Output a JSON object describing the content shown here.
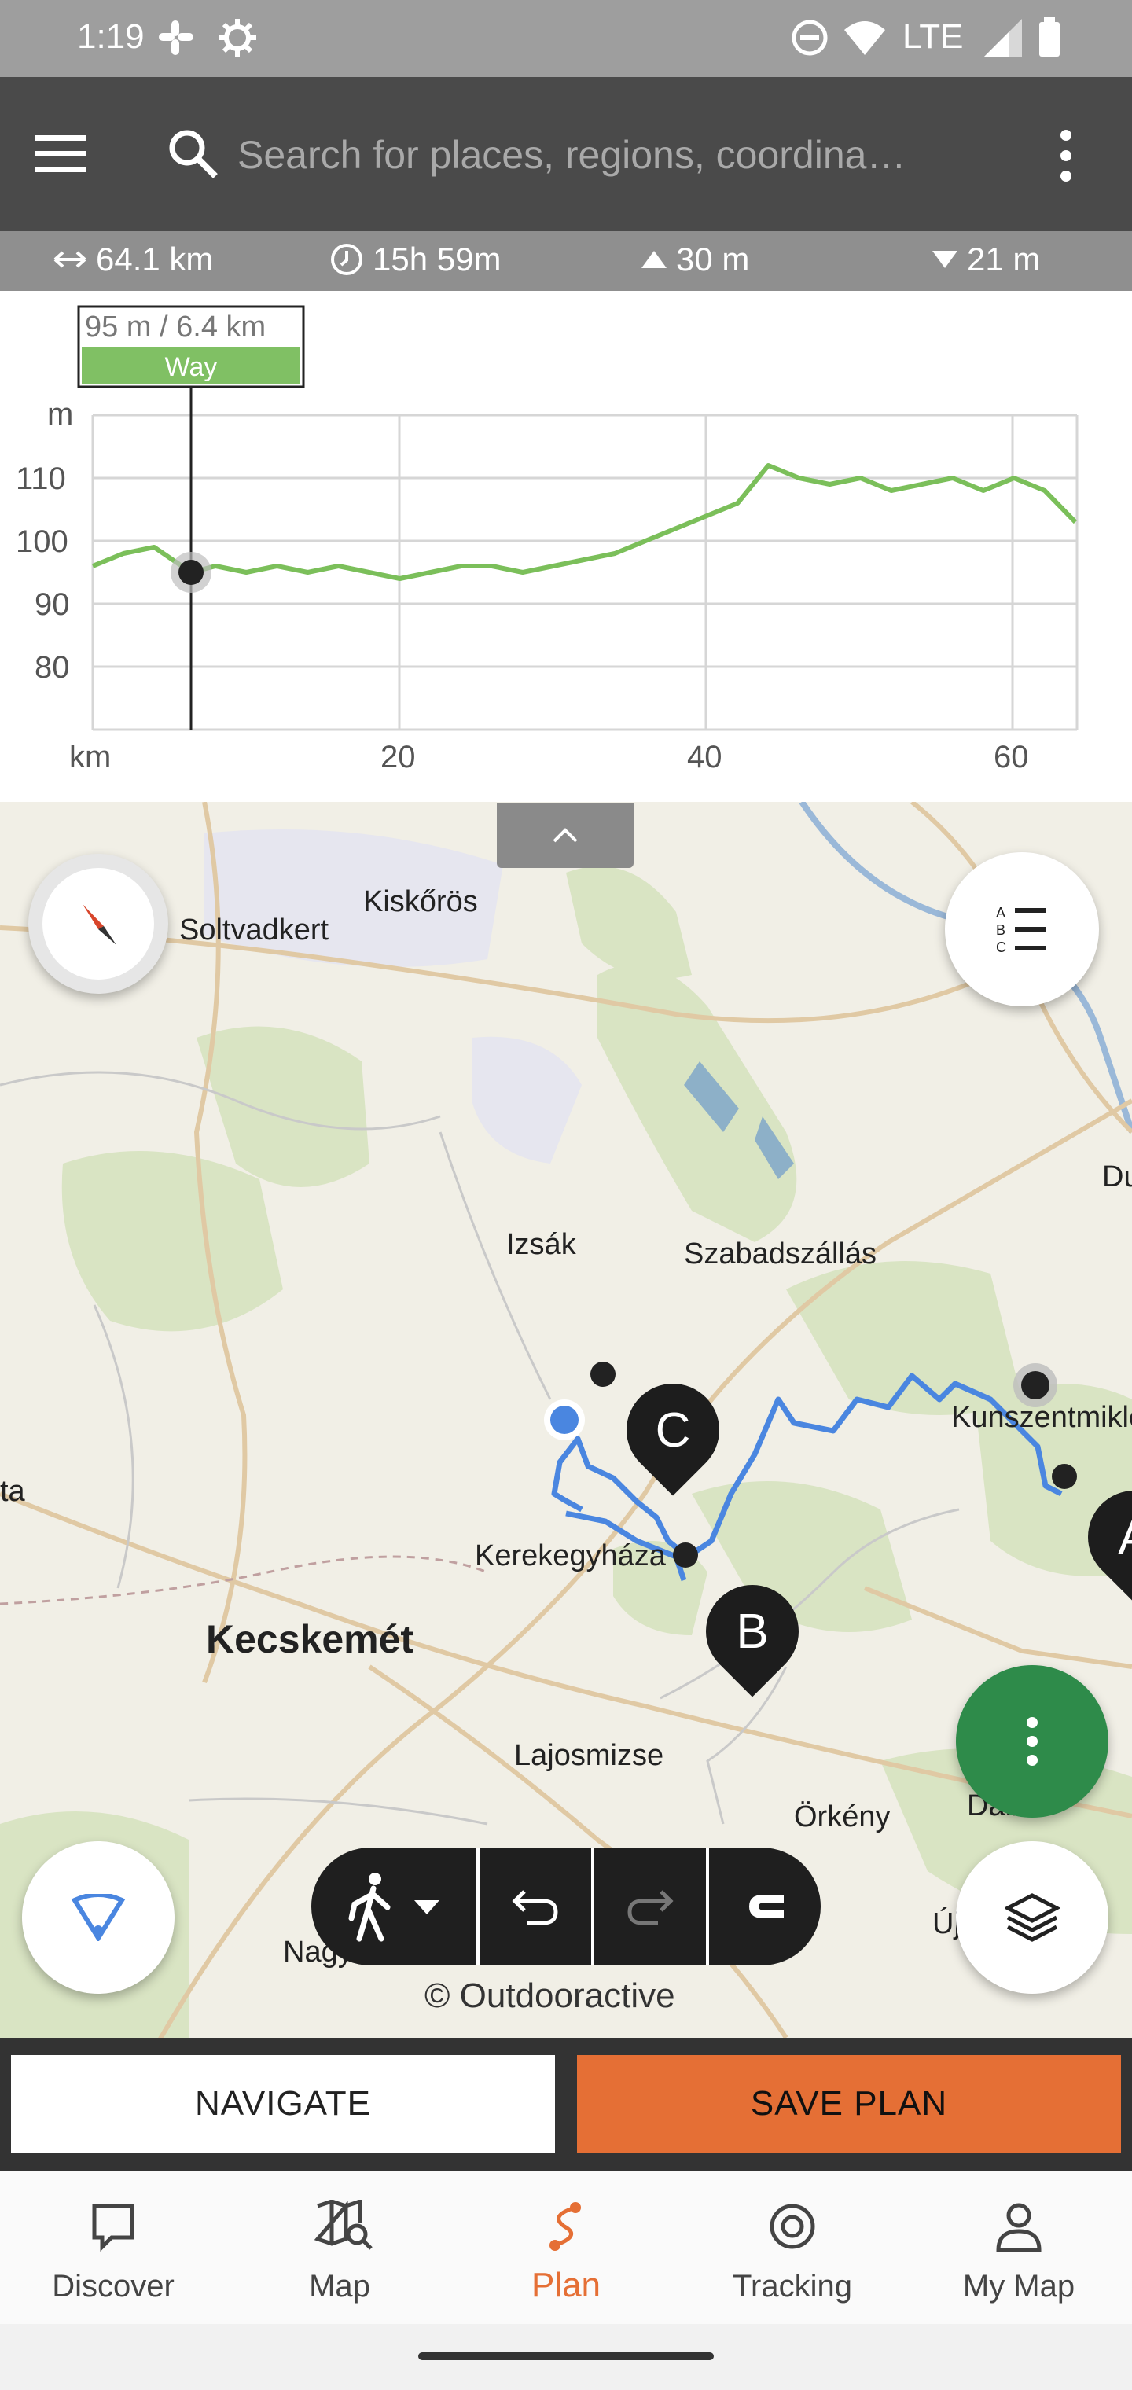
{
  "status_bar": {
    "time": "1:19",
    "network": "LTE"
  },
  "search": {
    "placeholder": "Search for places, regions, coordina…"
  },
  "stats": {
    "distance": "64.1 km",
    "duration": "15h 59m",
    "ascent": "30 m",
    "descent": "21 m"
  },
  "elevation": {
    "tooltip_value": "95 m / 6.4 km",
    "tooltip_type": "Way",
    "y_unit": "m",
    "x_unit": "km",
    "y_ticks": [
      "110",
      "100",
      "90",
      "80"
    ],
    "x_ticks": [
      "20",
      "40",
      "60"
    ]
  },
  "chart_data": {
    "type": "line",
    "xlabel": "km",
    "ylabel": "m",
    "xlim": [
      0,
      64.1
    ],
    "ylim": [
      70,
      120
    ],
    "x": [
      0,
      2,
      4,
      6.4,
      8,
      10,
      12,
      14,
      16,
      18,
      20,
      22,
      24,
      26,
      28,
      30,
      32,
      34,
      36,
      38,
      40,
      42,
      44,
      46,
      48,
      50,
      52,
      54,
      56,
      58,
      60,
      62,
      64
    ],
    "series": [
      {
        "values": [
          96,
          98,
          99,
          95,
          96,
          95,
          96,
          95,
          96,
          95,
          94,
          95,
          96,
          96,
          95,
          96,
          97,
          98,
          100,
          102,
          104,
          106,
          112,
          110,
          109,
          110,
          108,
          109,
          110,
          108,
          110,
          108,
          103
        ]
      }
    ],
    "marker": {
      "x": 6.4,
      "y": 95
    },
    "grid": true
  },
  "map": {
    "labels": {
      "soltvadkert": "Soltvadkert",
      "kiskoros": "Kiskőrös",
      "izsak": "Izsák",
      "szabadszallas": "Szabadszállás",
      "kunszentmiklos": "Kunszentmiklós",
      "kerekegyhaza": "Kerekegyháza",
      "kecskemet": "Kecskemét",
      "lajosmizse": "Lajosmizse",
      "orkeny": "Örkény",
      "dabas": "Dabas",
      "nagykoros": "Nagykőrös",
      "du": "Du",
      "uj": "Új",
      "ta": "ta"
    },
    "pins": [
      "A",
      "B",
      "C"
    ],
    "copyright": "© Outdooractive",
    "route_color": "#4a86e0"
  },
  "actions": {
    "navigate": "NAVIGATE",
    "save": "SAVE PLAN"
  },
  "nav": [
    {
      "label": "Discover",
      "icon": "discover-icon"
    },
    {
      "label": "Map",
      "icon": "map-search-icon"
    },
    {
      "label": "Plan",
      "icon": "plan-icon",
      "active": true
    },
    {
      "label": "Tracking",
      "icon": "tracking-icon"
    },
    {
      "label": "My Map",
      "icon": "profile-icon"
    }
  ],
  "colors": {
    "accent": "#e56f35",
    "fab_green": "#2e8b4a",
    "elevation_line": "#7bbf5a"
  }
}
